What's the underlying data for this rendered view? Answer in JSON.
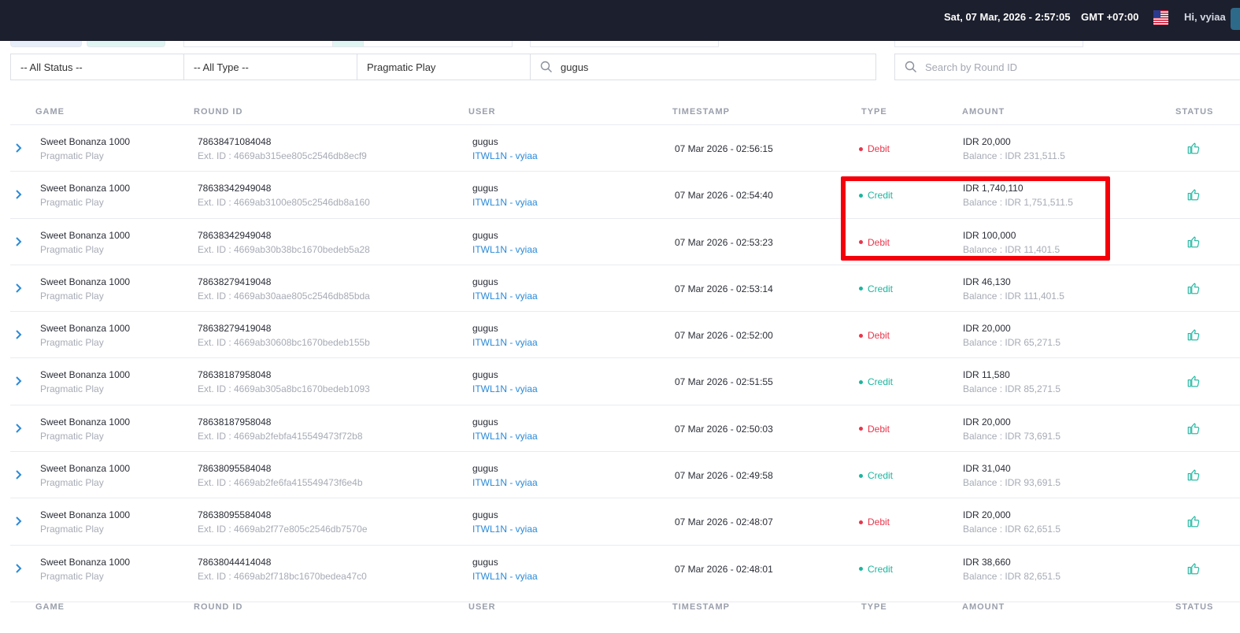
{
  "header": {
    "datetime": "Sat, 07 Mar, 2026 - 2:57:05",
    "timezone": "GMT +07:00",
    "greeting": "Hi, vyiaa"
  },
  "filters": {
    "status": "-- All Status --",
    "type": "-- All Type --",
    "provider": "Pragmatic Play",
    "user_search": "gugus",
    "round_search_placeholder": "Search by Round ID"
  },
  "columns": {
    "game": "GAME",
    "round_id": "ROUND ID",
    "user": "USER",
    "timestamp": "TIMESTAMP",
    "type": "TYPE",
    "amount": "AMOUNT",
    "status": "STATUS"
  },
  "colors": {
    "debit": "#e8354a",
    "credit": "#1cb59e",
    "status_icon": "#1cb59e",
    "highlight": "#f5000a"
  },
  "rows": [
    {
      "game": "Sweet Bonanza 1000",
      "provider": "Pragmatic Play",
      "round_id": "78638471084048",
      "ext_id": "Ext. ID : 4669ab315ee805c2546db8ecf9",
      "user": "gugus",
      "agent": "ITWL1N - vyiaa",
      "timestamp": "07 Mar 2026 - 02:56:15",
      "type": "Debit",
      "type_key": "debit",
      "amount": "IDR 20,000",
      "balance": "Balance : IDR 231,511.5",
      "status_icon": "thumbs-up-icon"
    },
    {
      "game": "Sweet Bonanza 1000",
      "provider": "Pragmatic Play",
      "round_id": "78638342949048",
      "ext_id": "Ext. ID : 4669ab3100e805c2546db8a160",
      "user": "gugus",
      "agent": "ITWL1N - vyiaa",
      "timestamp": "07 Mar 2026 - 02:54:40",
      "type": "Credit",
      "type_key": "credit",
      "amount": "IDR 1,740,110",
      "balance": "Balance : IDR 1,751,511.5",
      "status_icon": "thumbs-up-icon"
    },
    {
      "game": "Sweet Bonanza 1000",
      "provider": "Pragmatic Play",
      "round_id": "78638342949048",
      "ext_id": "Ext. ID : 4669ab30b38bc1670bedeb5a28",
      "user": "gugus",
      "agent": "ITWL1N - vyiaa",
      "timestamp": "07 Mar 2026 - 02:53:23",
      "type": "Debit",
      "type_key": "debit",
      "amount": "IDR 100,000",
      "balance": "Balance : IDR 11,401.5",
      "status_icon": "thumbs-up-icon"
    },
    {
      "game": "Sweet Bonanza 1000",
      "provider": "Pragmatic Play",
      "round_id": "78638279419048",
      "ext_id": "Ext. ID : 4669ab30aae805c2546db85bda",
      "user": "gugus",
      "agent": "ITWL1N - vyiaa",
      "timestamp": "07 Mar 2026 - 02:53:14",
      "type": "Credit",
      "type_key": "credit",
      "amount": "IDR 46,130",
      "balance": "Balance : IDR 111,401.5",
      "status_icon": "thumbs-up-icon"
    },
    {
      "game": "Sweet Bonanza 1000",
      "provider": "Pragmatic Play",
      "round_id": "78638279419048",
      "ext_id": "Ext. ID : 4669ab30608bc1670bedeb155b",
      "user": "gugus",
      "agent": "ITWL1N - vyiaa",
      "timestamp": "07 Mar 2026 - 02:52:00",
      "type": "Debit",
      "type_key": "debit",
      "amount": "IDR 20,000",
      "balance": "Balance : IDR 65,271.5",
      "status_icon": "thumbs-up-icon"
    },
    {
      "game": "Sweet Bonanza 1000",
      "provider": "Pragmatic Play",
      "round_id": "78638187958048",
      "ext_id": "Ext. ID : 4669ab305a8bc1670bedeb1093",
      "user": "gugus",
      "agent": "ITWL1N - vyiaa",
      "timestamp": "07 Mar 2026 - 02:51:55",
      "type": "Credit",
      "type_key": "credit",
      "amount": "IDR 11,580",
      "balance": "Balance : IDR 85,271.5",
      "status_icon": "thumbs-up-icon"
    },
    {
      "game": "Sweet Bonanza 1000",
      "provider": "Pragmatic Play",
      "round_id": "78638187958048",
      "ext_id": "Ext. ID : 4669ab2febfa415549473f72b8",
      "user": "gugus",
      "agent": "ITWL1N - vyiaa",
      "timestamp": "07 Mar 2026 - 02:50:03",
      "type": "Debit",
      "type_key": "debit",
      "amount": "IDR 20,000",
      "balance": "Balance : IDR 73,691.5",
      "status_icon": "thumbs-up-icon"
    },
    {
      "game": "Sweet Bonanza 1000",
      "provider": "Pragmatic Play",
      "round_id": "78638095584048",
      "ext_id": "Ext. ID : 4669ab2fe6fa415549473f6e4b",
      "user": "gugus",
      "agent": "ITWL1N - vyiaa",
      "timestamp": "07 Mar 2026 - 02:49:58",
      "type": "Credit",
      "type_key": "credit",
      "amount": "IDR 31,040",
      "balance": "Balance : IDR 93,691.5",
      "status_icon": "thumbs-up-icon"
    },
    {
      "game": "Sweet Bonanza 1000",
      "provider": "Pragmatic Play",
      "round_id": "78638095584048",
      "ext_id": "Ext. ID : 4669ab2f77e805c2546db7570e",
      "user": "gugus",
      "agent": "ITWL1N - vyiaa",
      "timestamp": "07 Mar 2026 - 02:48:07",
      "type": "Debit",
      "type_key": "debit",
      "amount": "IDR 20,000",
      "balance": "Balance : IDR 62,651.5",
      "status_icon": "thumbs-up-icon"
    },
    {
      "game": "Sweet Bonanza 1000",
      "provider": "Pragmatic Play",
      "round_id": "78638044414048",
      "ext_id": "Ext. ID : 4669ab2f718bc1670bedea47c0",
      "user": "gugus",
      "agent": "ITWL1N - vyiaa",
      "timestamp": "07 Mar 2026 - 02:48:01",
      "type": "Credit",
      "type_key": "credit",
      "amount": "IDR 38,660",
      "balance": "Balance : IDR 82,651.5",
      "status_icon": "thumbs-up-icon"
    }
  ]
}
